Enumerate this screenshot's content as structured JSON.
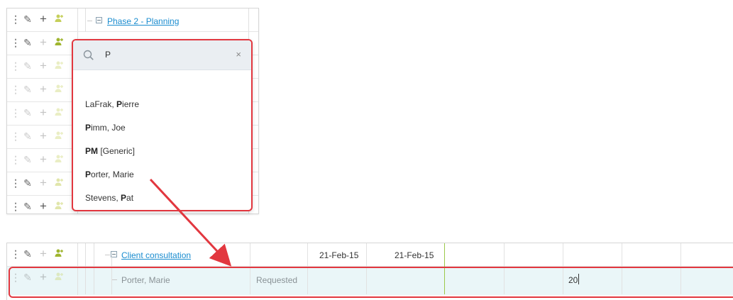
{
  "top_grid": {
    "phase_title": "Phase 2 - Planning"
  },
  "resource_search": {
    "query": "P",
    "clear_symbol": "×",
    "results": [
      {
        "pre": "LaFrak, ",
        "match": "P",
        "post": "ierre"
      },
      {
        "pre": "",
        "match": "P",
        "post": "imm, Joe"
      },
      {
        "pre": "",
        "match": "PM",
        "post": " [Generic]"
      },
      {
        "pre": "",
        "match": "P",
        "post": "orter, Marie"
      },
      {
        "pre": "Stevens, ",
        "match": "P",
        "post": "at"
      }
    ]
  },
  "bottom_grid": {
    "task_name": "Client consultation",
    "start_date": "21-Feb-15",
    "end_date": "21-Feb-15",
    "assignment": {
      "resource_name": "Porter, Marie",
      "status": "Requested",
      "hours": "20"
    }
  },
  "colors": {
    "link": "#1a8ccf",
    "highlight_border": "#e2373f",
    "row_highlight": "#eaf6f8",
    "today_line": "#9cc94a"
  },
  "icons": [
    "drag-handle-icon",
    "pencil-icon",
    "plus-icon",
    "add-resource-icon",
    "search-icon",
    "close-icon",
    "collapse-icon"
  ]
}
